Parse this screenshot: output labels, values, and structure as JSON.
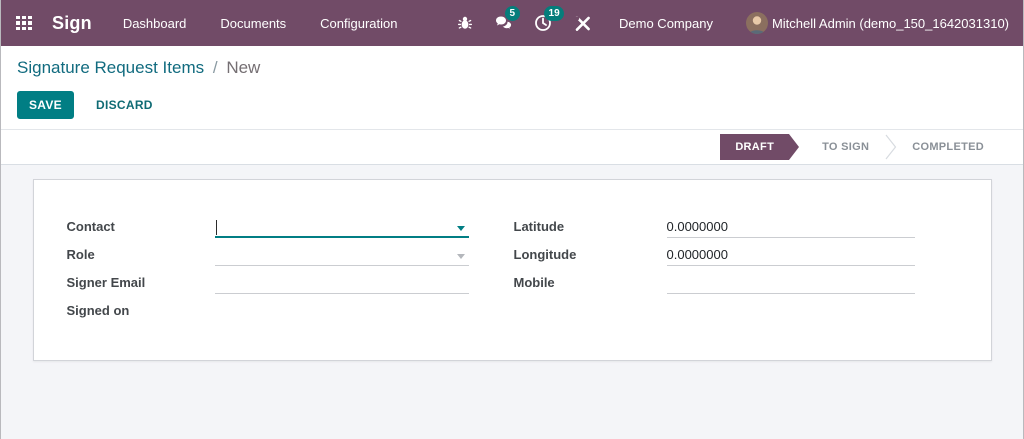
{
  "navbar": {
    "app_name": "Sign",
    "menu_items": [
      {
        "label": "Dashboard"
      },
      {
        "label": "Documents"
      },
      {
        "label": "Configuration"
      }
    ],
    "messages_badge": "5",
    "activities_badge": "19",
    "company_name": "Demo Company",
    "user_name": "Mitchell Admin (demo_150_1642031310)"
  },
  "breadcrumb": {
    "parent": "Signature Request Items",
    "separator": "/",
    "current": "New"
  },
  "actions": {
    "save": "SAVE",
    "discard": "DISCARD"
  },
  "statusbar": {
    "stages": [
      {
        "label": "DRAFT",
        "active": true
      },
      {
        "label": "TO SIGN",
        "active": false
      },
      {
        "label": "COMPLETED",
        "active": false
      }
    ]
  },
  "form": {
    "left": [
      {
        "label": "Contact",
        "value": "",
        "widget": "many2one",
        "focused": true
      },
      {
        "label": "Role",
        "value": "",
        "widget": "many2one",
        "focused": false
      },
      {
        "label": "Signer Email",
        "value": "",
        "widget": "char"
      },
      {
        "label": "Signed on",
        "value": "",
        "widget": "datetime"
      }
    ],
    "right": [
      {
        "label": "Latitude",
        "value": "0.0000000",
        "widget": "float"
      },
      {
        "label": "Longitude",
        "value": "0.0000000",
        "widget": "float"
      },
      {
        "label": "Mobile",
        "value": "",
        "widget": "char"
      }
    ]
  },
  "colors": {
    "navbar_bg": "#714B67",
    "badge_bg": "#057d7b",
    "primary_teal": "#017e84",
    "breadcrumb_link": "#116b7f",
    "stage_active_bg": "#714B67",
    "content_bg": "#f4f5f8"
  }
}
